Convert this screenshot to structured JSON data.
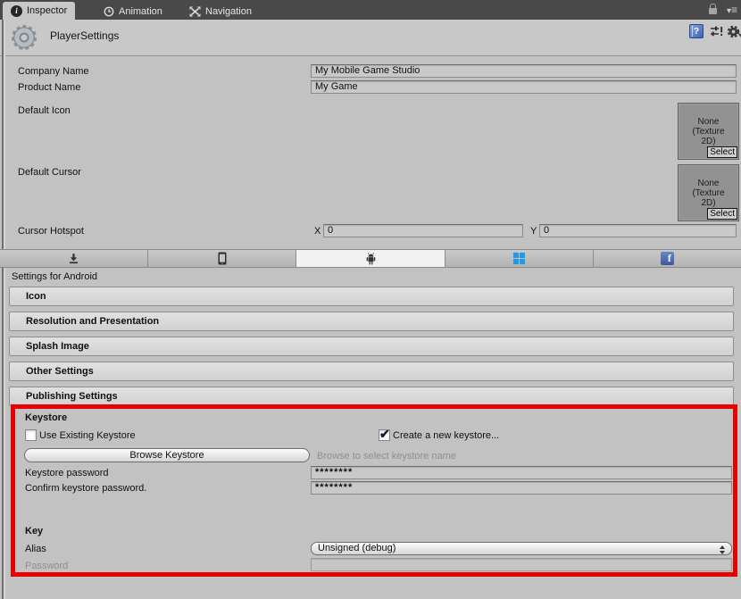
{
  "tabbar": {
    "inspector": "Inspector",
    "animation": "Animation",
    "navigation": "Navigation"
  },
  "header": {
    "title": "PlayerSettings"
  },
  "player": {
    "company": {
      "label": "Company Name",
      "value": "My Mobile Game Studio"
    },
    "product": {
      "label": "Product Name",
      "value": "My Game"
    },
    "default_icon": {
      "label": "Default Icon",
      "none": "None\n(Texture\n2D)",
      "select": "Select"
    },
    "default_cursor": {
      "label": "Default Cursor",
      "none": "None\n(Texture\n2D)",
      "select": "Select"
    },
    "hotspot": {
      "label": "Cursor Hotspot",
      "x": "X",
      "x_value": "0",
      "y": "Y",
      "y_value": "0"
    }
  },
  "platform": {
    "settings_title": "Settings for Android",
    "tabs": [
      "standalone-download-icon",
      "ios-smartphone-icon",
      "android-robot-icon",
      "windows-logo-icon",
      "facebook-logo-icon"
    ],
    "selected": "android",
    "sections": [
      "Icon",
      "Resolution and Presentation",
      "Splash Image",
      "Other Settings",
      "Publishing Settings"
    ]
  },
  "publishing": {
    "keystore_heading": "Keystore",
    "use_existing_label": "Use Existing Keystore",
    "use_existing_checked": false,
    "create_new_label": "Create a new keystore...",
    "create_new_checked": true,
    "browse_button": "Browse Keystore",
    "browse_hint": "Browse to select keystore name",
    "keystore_password": {
      "label": "Keystore password",
      "value": "********"
    },
    "confirm_password": {
      "label": "Confirm keystore password.",
      "value": "********"
    },
    "key_heading": "Key",
    "alias": {
      "label": "Alias",
      "value": "Unsigned (debug)"
    },
    "password": {
      "label": "Password",
      "value": ""
    }
  },
  "colors": {
    "annotation_red": "#e60202",
    "windows_blue": "#1f9ae7",
    "facebook_blue": "#3b5998",
    "help_blue": "#3d62ae",
    "topbar_dark": "#494949",
    "panel_gray": "#c2c2c2"
  }
}
